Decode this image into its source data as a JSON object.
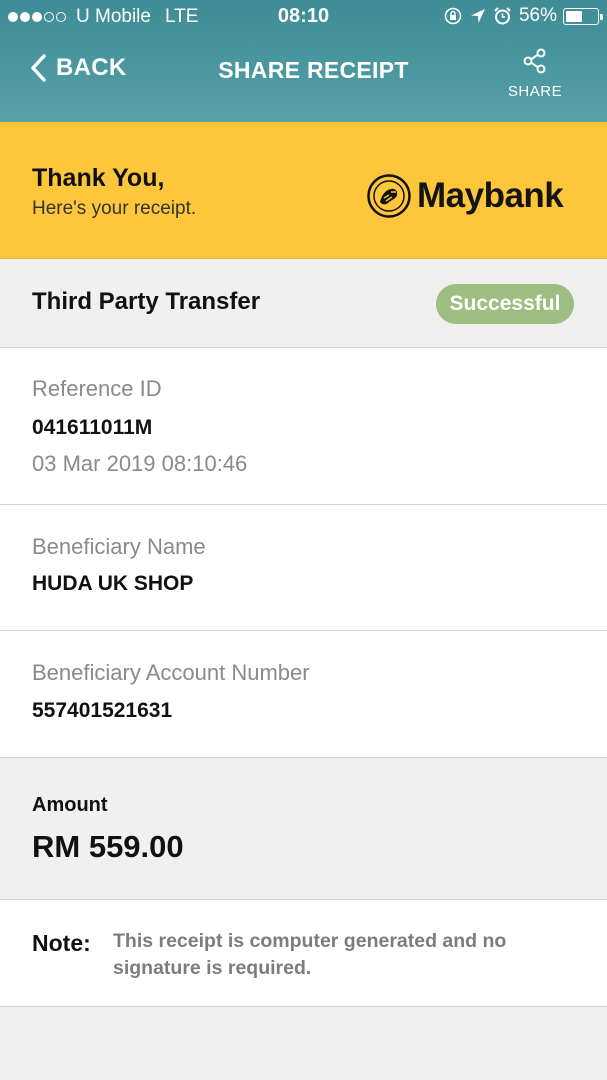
{
  "status_bar": {
    "carrier": "U Mobile",
    "network": "LTE",
    "time": "08:10",
    "battery": "56%",
    "battery_level": 0.56,
    "signal_bars": 3,
    "signal_total": 5
  },
  "nav": {
    "back_label": "BACK",
    "title": "SHARE RECEIPT",
    "share_label": "SHARE"
  },
  "banner": {
    "heading": "Thank You,",
    "subheading": "Here's your receipt.",
    "brand": "Maybank",
    "background_color": "#fec63a"
  },
  "transaction": {
    "type": "Third Party Transfer",
    "status": "Successful",
    "status_color": "#9dbd81"
  },
  "reference": {
    "label": "Reference ID",
    "id": "041611011M",
    "datetime": "03 Mar 2019 08:10:46"
  },
  "beneficiary": {
    "name_label": "Beneficiary Name",
    "name": "HUDA UK SHOP",
    "account_label": "Beneficiary Account Number",
    "account_number": "557401521631"
  },
  "amount": {
    "label": "Amount",
    "value": "RM 559.00"
  },
  "note": {
    "label": "Note:",
    "text": "This receipt is computer generated and no signature is required."
  },
  "icons": {
    "back": "chevron-left-icon",
    "share": "share-icon",
    "lock_rotation": "lock-rotation-icon",
    "location": "location-arrow-icon",
    "alarm": "alarm-icon",
    "battery": "battery-icon",
    "logo": "maybank-tiger-emblem"
  },
  "colors": {
    "header": "#4a97a0",
    "accent_yellow": "#fec63a",
    "success_green": "#9dbd81"
  }
}
